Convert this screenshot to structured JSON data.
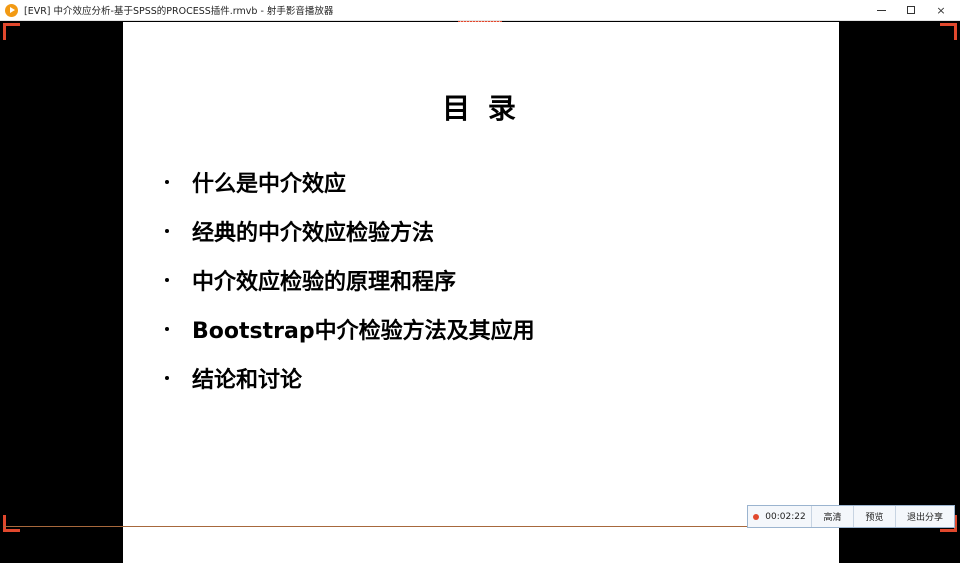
{
  "window": {
    "title": "[EVR] 中介效应分析-基于SPSS的PROCESS插件.rmvb - 射手影音播放器",
    "minimize_glyph": "minimize-icon",
    "maximize_glyph": "maximize-icon",
    "close_glyph": "×"
  },
  "slide": {
    "title": "目 录",
    "items": [
      "什么是中介效应",
      "经典的中介效应检验方法",
      "中介效应检验的原理和程序",
      "Bootstrap中介检验方法及其应用",
      "结论和讨论"
    ]
  },
  "toolbar": {
    "timer": "00:02:22",
    "hd": "高清",
    "preview": "预览",
    "exit_share": "退出分享"
  },
  "colors": {
    "accent": "#e1482d",
    "app_icon": "#f29a14"
  }
}
